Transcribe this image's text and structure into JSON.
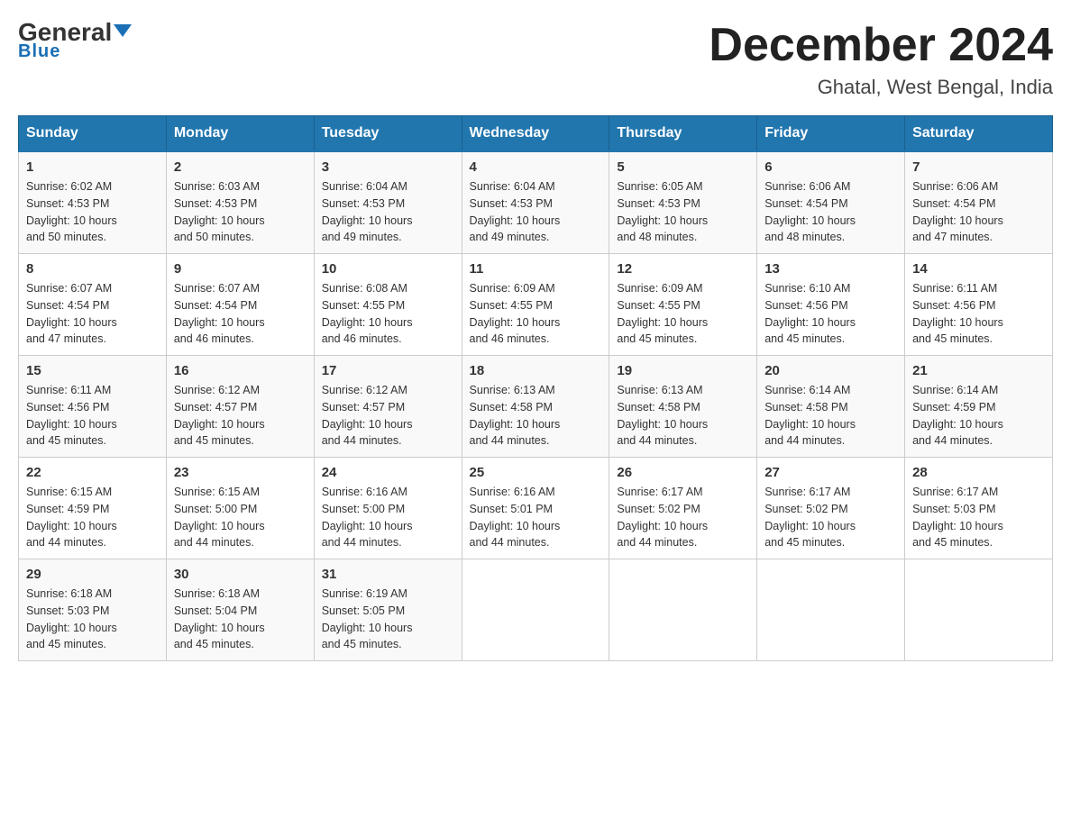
{
  "logo": {
    "general": "General",
    "blue": "Blue",
    "tagline": "Blue"
  },
  "title": "December 2024",
  "location": "Ghatal, West Bengal, India",
  "headers": [
    "Sunday",
    "Monday",
    "Tuesday",
    "Wednesday",
    "Thursday",
    "Friday",
    "Saturday"
  ],
  "weeks": [
    [
      {
        "day": "1",
        "sunrise": "6:02 AM",
        "sunset": "4:53 PM",
        "daylight": "10 hours and 50 minutes."
      },
      {
        "day": "2",
        "sunrise": "6:03 AM",
        "sunset": "4:53 PM",
        "daylight": "10 hours and 50 minutes."
      },
      {
        "day": "3",
        "sunrise": "6:04 AM",
        "sunset": "4:53 PM",
        "daylight": "10 hours and 49 minutes."
      },
      {
        "day": "4",
        "sunrise": "6:04 AM",
        "sunset": "4:53 PM",
        "daylight": "10 hours and 49 minutes."
      },
      {
        "day": "5",
        "sunrise": "6:05 AM",
        "sunset": "4:53 PM",
        "daylight": "10 hours and 48 minutes."
      },
      {
        "day": "6",
        "sunrise": "6:06 AM",
        "sunset": "4:54 PM",
        "daylight": "10 hours and 48 minutes."
      },
      {
        "day": "7",
        "sunrise": "6:06 AM",
        "sunset": "4:54 PM",
        "daylight": "10 hours and 47 minutes."
      }
    ],
    [
      {
        "day": "8",
        "sunrise": "6:07 AM",
        "sunset": "4:54 PM",
        "daylight": "10 hours and 47 minutes."
      },
      {
        "day": "9",
        "sunrise": "6:07 AM",
        "sunset": "4:54 PM",
        "daylight": "10 hours and 46 minutes."
      },
      {
        "day": "10",
        "sunrise": "6:08 AM",
        "sunset": "4:55 PM",
        "daylight": "10 hours and 46 minutes."
      },
      {
        "day": "11",
        "sunrise": "6:09 AM",
        "sunset": "4:55 PM",
        "daylight": "10 hours and 46 minutes."
      },
      {
        "day": "12",
        "sunrise": "6:09 AM",
        "sunset": "4:55 PM",
        "daylight": "10 hours and 45 minutes."
      },
      {
        "day": "13",
        "sunrise": "6:10 AM",
        "sunset": "4:56 PM",
        "daylight": "10 hours and 45 minutes."
      },
      {
        "day": "14",
        "sunrise": "6:11 AM",
        "sunset": "4:56 PM",
        "daylight": "10 hours and 45 minutes."
      }
    ],
    [
      {
        "day": "15",
        "sunrise": "6:11 AM",
        "sunset": "4:56 PM",
        "daylight": "10 hours and 45 minutes."
      },
      {
        "day": "16",
        "sunrise": "6:12 AM",
        "sunset": "4:57 PM",
        "daylight": "10 hours and 45 minutes."
      },
      {
        "day": "17",
        "sunrise": "6:12 AM",
        "sunset": "4:57 PM",
        "daylight": "10 hours and 44 minutes."
      },
      {
        "day": "18",
        "sunrise": "6:13 AM",
        "sunset": "4:58 PM",
        "daylight": "10 hours and 44 minutes."
      },
      {
        "day": "19",
        "sunrise": "6:13 AM",
        "sunset": "4:58 PM",
        "daylight": "10 hours and 44 minutes."
      },
      {
        "day": "20",
        "sunrise": "6:14 AM",
        "sunset": "4:58 PM",
        "daylight": "10 hours and 44 minutes."
      },
      {
        "day": "21",
        "sunrise": "6:14 AM",
        "sunset": "4:59 PM",
        "daylight": "10 hours and 44 minutes."
      }
    ],
    [
      {
        "day": "22",
        "sunrise": "6:15 AM",
        "sunset": "4:59 PM",
        "daylight": "10 hours and 44 minutes."
      },
      {
        "day": "23",
        "sunrise": "6:15 AM",
        "sunset": "5:00 PM",
        "daylight": "10 hours and 44 minutes."
      },
      {
        "day": "24",
        "sunrise": "6:16 AM",
        "sunset": "5:00 PM",
        "daylight": "10 hours and 44 minutes."
      },
      {
        "day": "25",
        "sunrise": "6:16 AM",
        "sunset": "5:01 PM",
        "daylight": "10 hours and 44 minutes."
      },
      {
        "day": "26",
        "sunrise": "6:17 AM",
        "sunset": "5:02 PM",
        "daylight": "10 hours and 44 minutes."
      },
      {
        "day": "27",
        "sunrise": "6:17 AM",
        "sunset": "5:02 PM",
        "daylight": "10 hours and 45 minutes."
      },
      {
        "day": "28",
        "sunrise": "6:17 AM",
        "sunset": "5:03 PM",
        "daylight": "10 hours and 45 minutes."
      }
    ],
    [
      {
        "day": "29",
        "sunrise": "6:18 AM",
        "sunset": "5:03 PM",
        "daylight": "10 hours and 45 minutes."
      },
      {
        "day": "30",
        "sunrise": "6:18 AM",
        "sunset": "5:04 PM",
        "daylight": "10 hours and 45 minutes."
      },
      {
        "day": "31",
        "sunrise": "6:19 AM",
        "sunset": "5:05 PM",
        "daylight": "10 hours and 45 minutes."
      },
      null,
      null,
      null,
      null
    ]
  ],
  "labels": {
    "sunrise": "Sunrise:",
    "sunset": "Sunset:",
    "daylight": "Daylight:"
  }
}
